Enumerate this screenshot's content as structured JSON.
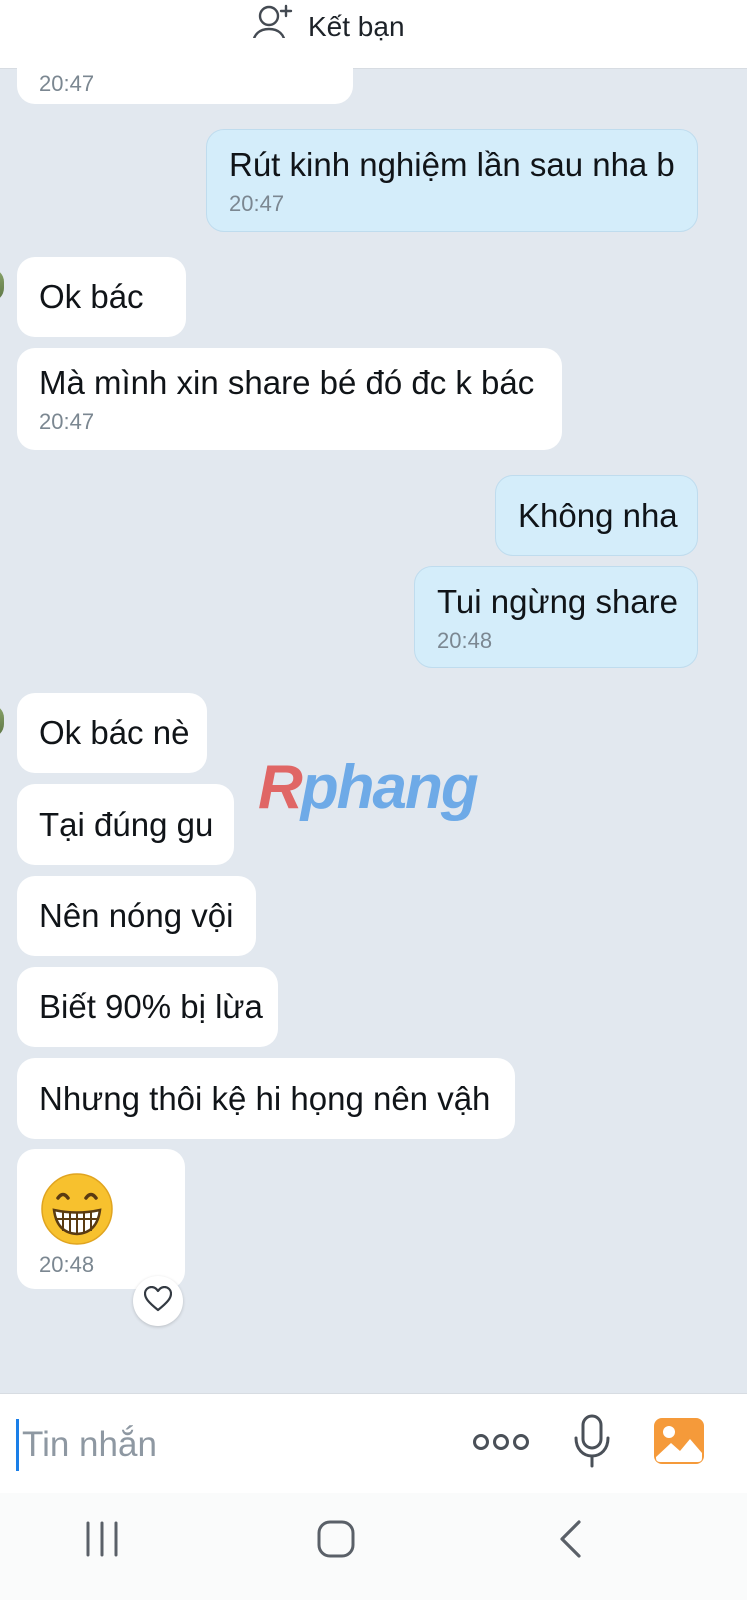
{
  "header": {
    "add_friend_label": "Kết bạn",
    "add_friend_icon": "add-user-icon"
  },
  "messages": [
    {
      "dir": "in",
      "text": "",
      "time": "20:47"
    },
    {
      "dir": "out",
      "text": "Rút kinh nghiệm lần sau nha b",
      "time": "20:47"
    },
    {
      "dir": "in",
      "text": "Ok bác",
      "time": ""
    },
    {
      "dir": "in",
      "text": "Mà mình xin share bé đó đc k bác",
      "time": "20:47"
    },
    {
      "dir": "out",
      "text": "Không nha",
      "time": ""
    },
    {
      "dir": "out",
      "text": "Tui ngừng share",
      "time": "20:48"
    },
    {
      "dir": "in",
      "text": "Ok bác nè",
      "time": ""
    },
    {
      "dir": "in",
      "text": "Tại đúng gu",
      "time": ""
    },
    {
      "dir": "in",
      "text": "Nên nóng vội",
      "time": ""
    },
    {
      "dir": "in",
      "text": "Biết 90% bị lừa",
      "time": ""
    },
    {
      "dir": "in",
      "text": "Nhưng thôi kệ hi họng nên vậh",
      "time": ""
    },
    {
      "dir": "in",
      "text": "",
      "emoji": "grinning-face-emoji",
      "time": "20:48"
    }
  ],
  "watermark": {
    "part1": "R",
    "part2": "phang"
  },
  "reaction": {
    "icon": "heart-icon"
  },
  "composer": {
    "placeholder": "Tin nhắn",
    "more_icon": "more-dots-icon",
    "mic_icon": "microphone-icon",
    "image_icon": "image-icon"
  },
  "navbar": {
    "recent_icon": "recent-apps-icon",
    "home_icon": "home-icon",
    "back_icon": "back-icon"
  },
  "colors": {
    "chat_background": "#e2e8ef",
    "outgoing_bubble": "#d4edfa",
    "incoming_bubble": "#ffffff",
    "accent": "#1a7fe8"
  }
}
